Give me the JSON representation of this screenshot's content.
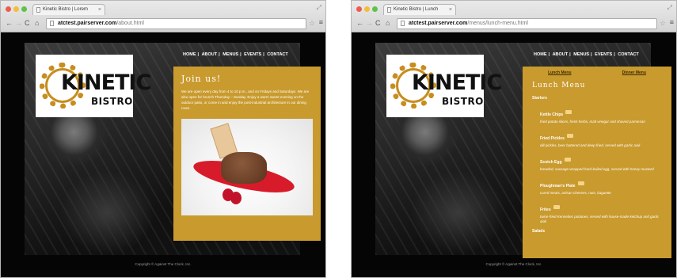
{
  "window1": {
    "tab_title": "Kinetic Bistro | Lorem",
    "url_host": "atctest.pairserver.com",
    "url_path": "/about.html",
    "logo": {
      "main": "KINETIC",
      "sub": "BISTRO"
    },
    "nav": [
      "HOME",
      "ABOUT",
      "MENUS",
      "EVENTS",
      "CONTACT"
    ],
    "panel_title": "Join us!",
    "panel_text": "We are open every day from 4 to 10 p.m., and on Fridays and Saturdays. We are also open for brunch Thursday – Sunday. Enjoy a warm sweet evening on the outdoor patio, or come in and enjoy the post-industrial architecture in our dining room.",
    "footer": "Copyright © Against The Clock, Inc."
  },
  "window2": {
    "tab_title": "Kinetic Bistro | Lunch",
    "url_host": "atctest.pairserver.com",
    "url_path": "/menus/lunch-menu.html",
    "logo": {
      "main": "KINETIC",
      "sub": "BISTRO"
    },
    "nav": [
      "HOME",
      "ABOUT",
      "MENUS",
      "EVENTS",
      "CONTACT"
    ],
    "sub_links": [
      "Lunch Menu",
      "Dinner Menu"
    ],
    "menu_title": "Lunch Menu",
    "section1": "Starters",
    "items": [
      {
        "name": "Kettle Chips",
        "desc": "fried potato slices, fresh herbs, malt vinegar and shaved parmesan"
      },
      {
        "name": "Fried Pickles",
        "desc": "dill pickles, beer battered and deep fried, served with garlic aioli"
      },
      {
        "name": "Scotch Egg",
        "desc": "breaded, sausage-wrapped hard-boiled egg, served with honey mustard"
      },
      {
        "name": "Ploughman's Plate",
        "desc": "cured meats, artisan cheeses, nuts, baguette"
      },
      {
        "name": "Frites",
        "desc": "twice-fried Kennebec potatoes, served with house-made ketchup and garlic aioli"
      }
    ],
    "section2": "Salads",
    "footer": "Copyright © Against The Clock, Inc."
  },
  "icons": {
    "back": "←",
    "forward": "→",
    "reload": "C",
    "home": "⌂",
    "star": "☆",
    "menu": "≡",
    "close": "×",
    "resize": "⤢"
  }
}
